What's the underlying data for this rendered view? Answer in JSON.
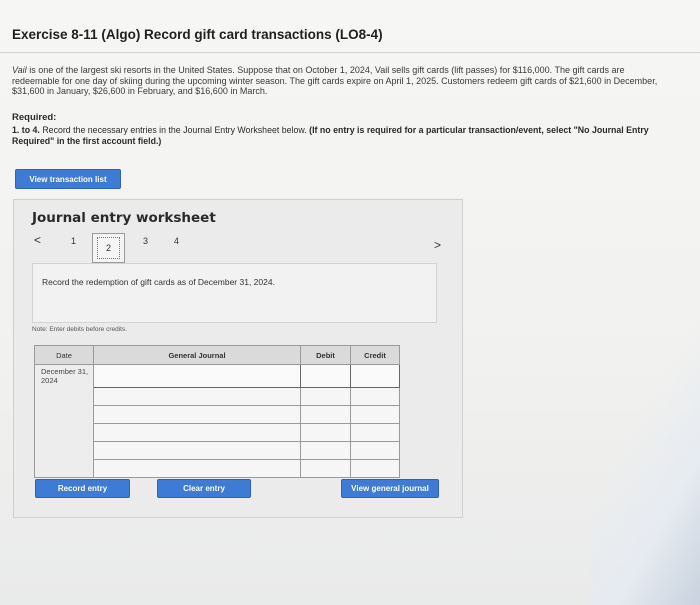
{
  "header": {
    "title": "Exercise 8-11 (Algo) Record gift card transactions (LO8-4)"
  },
  "intro": {
    "company": "Vail",
    "text": " is one of the largest ski resorts in the United States. Suppose that on October 1, 2024, Vail sells gift cards (lift passes) for $116,000. The gift cards are redeemable for one day of skiing during the upcoming winter season. The gift cards expire on April 1, 2025. Customers redeem gift cards of $21,600 in December, $31,600 in January, $26,600 in February, and $16,600 in March."
  },
  "required": {
    "heading": "Required:",
    "prefix": "1. to 4.",
    "text": " Record the necessary entries in the Journal Entry Worksheet below. ",
    "bold_note": "(If no entry is required for a particular transaction/event, select \"No Journal Entry Required\" in the first account field.)"
  },
  "buttons": {
    "view_transaction_list": "View transaction list",
    "record_entry": "Record entry",
    "clear_entry": "Clear entry",
    "view_general_journal": "View general journal"
  },
  "worksheet": {
    "title": "Journal entry worksheet",
    "pages": [
      "1",
      "2",
      "3",
      "4"
    ],
    "current_page": "2",
    "prev": "<",
    "next": ">",
    "instruction": "Record the redemption of gift cards as of December 31, 2024.",
    "note": "Note: Enter debits before credits."
  },
  "table": {
    "headers": {
      "date": "Date",
      "account": "General Journal",
      "debit": "Debit",
      "credit": "Credit"
    },
    "date_value": "December 31, 2024",
    "rows": 6
  },
  "colors": {
    "button": "#3d7bd5",
    "panel": "#ebebeb"
  }
}
